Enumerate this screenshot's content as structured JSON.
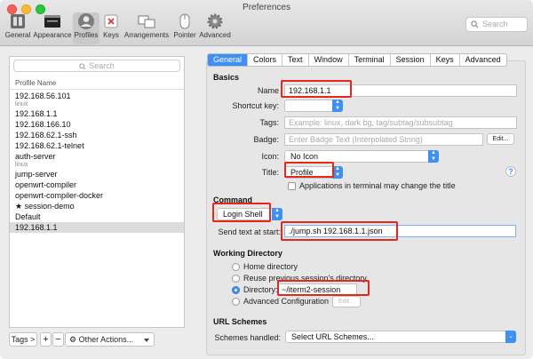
{
  "window": {
    "title": "Preferences"
  },
  "toolbar": {
    "items": [
      {
        "label": "General",
        "icon": "switch-icon"
      },
      {
        "label": "Appearance",
        "icon": "window-icon"
      },
      {
        "label": "Profiles",
        "icon": "person-icon"
      },
      {
        "label": "Keys",
        "icon": "keyboard-icon"
      },
      {
        "label": "Arrangements",
        "icon": "arrangements-icon"
      },
      {
        "label": "Pointer",
        "icon": "mouse-icon"
      },
      {
        "label": "Advanced",
        "icon": "gear-icon"
      }
    ],
    "search_placeholder": "Search"
  },
  "left": {
    "search_placeholder": "Search",
    "header": "Profile Name",
    "profiles": [
      {
        "name": "192.168.56.101",
        "tag": "linux"
      },
      {
        "name": "192.168.1.1",
        "tag": ""
      },
      {
        "name": "192.168.166.10",
        "tag": ""
      },
      {
        "name": "192.168.62.1-ssh",
        "tag": ""
      },
      {
        "name": "192.168.62.1-telnet",
        "tag": ""
      },
      {
        "name": "auth-server",
        "tag": "linux"
      },
      {
        "name": "jump-server",
        "tag": ""
      },
      {
        "name": "openwrt-compiler",
        "tag": ""
      },
      {
        "name": "openwrt-compiler-docker",
        "tag": ""
      },
      {
        "name": "★ session-demo",
        "tag": ""
      },
      {
        "name": "Default",
        "tag": ""
      },
      {
        "name": "192.168.1.1",
        "tag": ""
      }
    ],
    "selected_index": 11,
    "footer": {
      "tags_label": "Tags >",
      "add_label": "+",
      "remove_label": "−",
      "other_actions_label": "Other Actions..."
    }
  },
  "tabs": [
    "General",
    "Colors",
    "Text",
    "Window",
    "Terminal",
    "Session",
    "Keys",
    "Advanced"
  ],
  "active_tab": "General",
  "basics": {
    "title": "Basics",
    "name_label": "Name",
    "name_value": "192.168.1.1",
    "shortcut_label": "Shortcut key:",
    "tags_label": "Tags:",
    "tags_placeholder": "Example: linux, dark bg, tag/subtag/subsubtag",
    "badge_label": "Badge:",
    "badge_placeholder": "Enter Badge Text (Interpolated String)",
    "badge_edit": "Edit...",
    "icon_label": "Icon:",
    "icon_value": "No Icon",
    "title_label": "Title:",
    "title_value": "Profile",
    "apps_change_title": "Applications in terminal may change the title",
    "help": "?"
  },
  "command": {
    "title": "Command",
    "mode_value": "Login Shell",
    "send_text_label": "Send text at start:",
    "send_text_value": "./jump.sh 192.168.1.1.json"
  },
  "working_directory": {
    "title": "Working Directory",
    "options": [
      "Home directory",
      "Reuse previous session's directory",
      "Directory:",
      "Advanced Configuration"
    ],
    "selected": "Directory:",
    "directory_value": "~/iterm2-session",
    "edit_label": "Edit..."
  },
  "url_schemes": {
    "title": "URL Schemes",
    "label": "Schemes handled:",
    "value": "Select URL Schemes..."
  },
  "colors": {
    "accent": "#3e90f5",
    "highlight": "#e5271c"
  }
}
